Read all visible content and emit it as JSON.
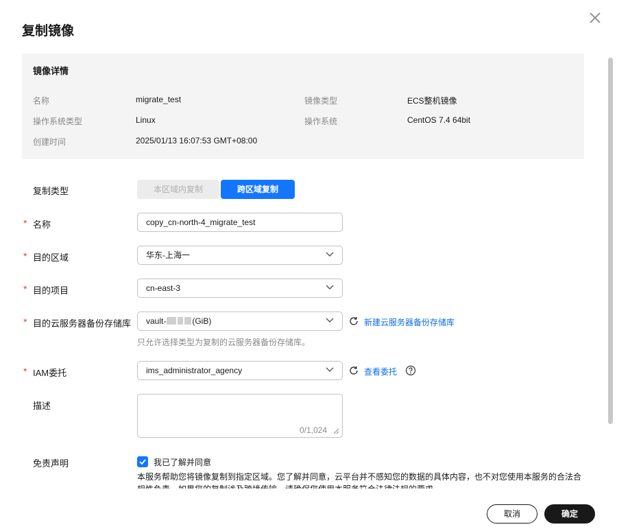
{
  "dialog": {
    "title": "复制镜像",
    "close_icon": "close-icon"
  },
  "details": {
    "title": "镜像详情",
    "name_label": "名称",
    "name_value": "migrate_test",
    "image_type_label": "镜像类型",
    "image_type_value": "ECS整机镜像",
    "os_type_label": "操作系统类型",
    "os_type_value": "Linux",
    "os_label": "操作系统",
    "os_value": "CentOS 7.4 64bit",
    "created_label": "创建时间",
    "created_value": "2025/01/13 16:07:53 GMT+08:00"
  },
  "form": {
    "copy_type": {
      "label": "复制类型",
      "option_local": "本区域内复制",
      "option_cross": "跨区域复制",
      "selected": "跨区域复制"
    },
    "name": {
      "label": "名称",
      "value": "copy_cn-north-4_migrate_test"
    },
    "region": {
      "label": "目的区域",
      "value": "华东-上海一"
    },
    "project": {
      "label": "目的项目",
      "value": "cn-east-3"
    },
    "vault": {
      "label": "目的云服务器备份存储库",
      "value_prefix": "vault-",
      "value_suffix": "GiB)",
      "create_link": "新建云服务器备份存储库",
      "hint": "只允许选择类型为复制的云服务器备份存储库。"
    },
    "iam": {
      "label": "IAM委托",
      "value": "ims_administrator_agency",
      "view_link": "查看委托"
    },
    "description": {
      "label": "描述",
      "counter": "0/1,024"
    },
    "disclaimer": {
      "label": "免责声明",
      "checked": true,
      "agree_text": "我已了解并同意",
      "text": "本服务帮助您将镜像复制到指定区域。您了解并同意，云平台并不感知您的数据的具体内容，也不对您使用本服务的合法合规性负责。如果您的复制涉及跨境传输，请确保您使用本服务符合法律法规的要求。"
    }
  },
  "footer": {
    "cancel_label": "取消",
    "confirm_label": "确定"
  },
  "colors": {
    "primary": "#1476ff",
    "required": "#e0403b",
    "link": "#0d6ee0",
    "dark_button": "#191919"
  }
}
